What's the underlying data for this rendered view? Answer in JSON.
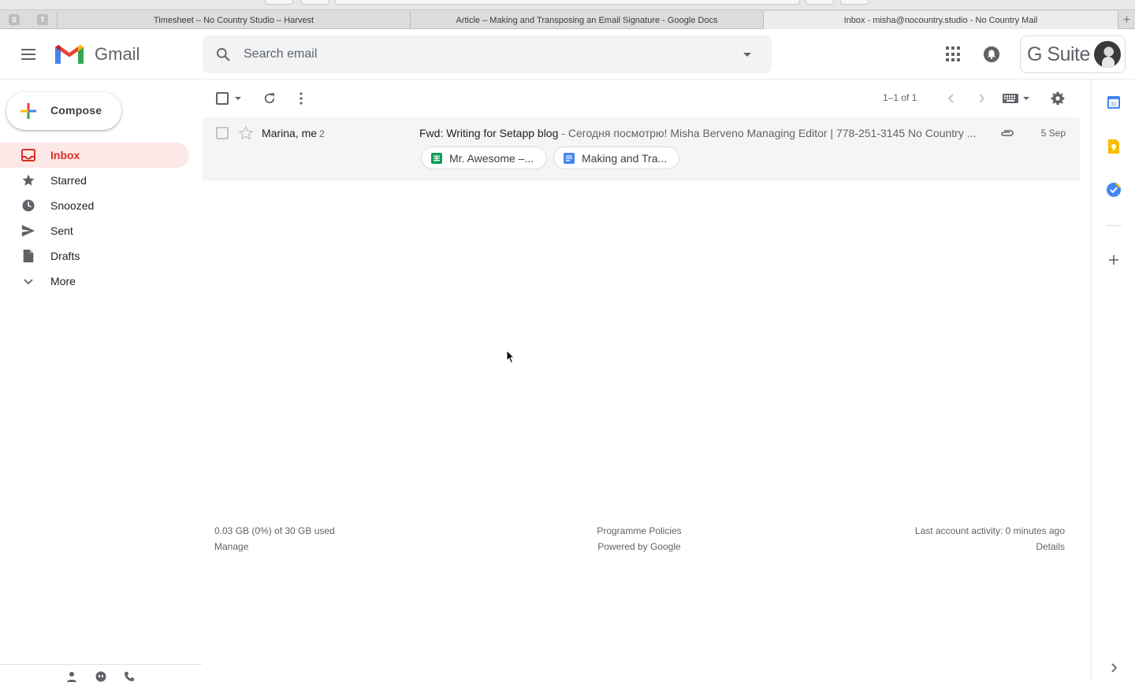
{
  "browser": {
    "pinned": [
      "S",
      "T"
    ],
    "tabs": [
      {
        "title": "Timesheet – No Country Studio – Harvest",
        "active": false
      },
      {
        "title": "Article – Making and Transposing an Email Signature - Google Docs",
        "active": false
      },
      {
        "title": "Inbox - misha@nocountry.studio - No Country Mail",
        "active": true
      }
    ],
    "new_tab": "+"
  },
  "header": {
    "app_name": "Gmail",
    "search_placeholder": "Search email",
    "brand": "G Suite"
  },
  "compose": {
    "label": "Compose"
  },
  "sidebar": {
    "items": [
      {
        "label": "Inbox",
        "icon": "inbox-icon",
        "active": true
      },
      {
        "label": "Starred",
        "icon": "star-icon",
        "active": false
      },
      {
        "label": "Snoozed",
        "icon": "clock-icon",
        "active": false
      },
      {
        "label": "Sent",
        "icon": "send-icon",
        "active": false
      },
      {
        "label": "Drafts",
        "icon": "draft-icon",
        "active": false
      },
      {
        "label": "More",
        "icon": "chevron-down-icon",
        "active": false
      }
    ]
  },
  "toolbar": {
    "pager": "1–1 of 1"
  },
  "emails": [
    {
      "sender": "Marina, me",
      "thread_count": "2",
      "subject": "Fwd: Writing for Setapp blog",
      "snippet": " - Сегодня посмотрю! Misha Berveno Managing Editor | 778-251-3145 No Country ...",
      "date": "5 Sep",
      "has_attachment": true,
      "attachments": [
        {
          "name": "Mr. Awesome –...",
          "type": "sheets-icon",
          "color": "#0f9d58"
        },
        {
          "name": "Making and Tra...",
          "type": "docs-icon",
          "color": "#4285f4"
        }
      ]
    }
  ],
  "footer": {
    "storage": "0.03 GB (0%) of 30 GB used",
    "manage": "Manage",
    "policies": "Programme Policies",
    "powered": "Powered by Google",
    "activity": "Last account activity: 0 minutes ago",
    "details": "Details"
  },
  "colors": {
    "accent": "#d93025",
    "active_bg": "#fce8e6",
    "calendar": "#4285f4",
    "keep": "#fbbc04",
    "tasks": "#4285f4"
  }
}
